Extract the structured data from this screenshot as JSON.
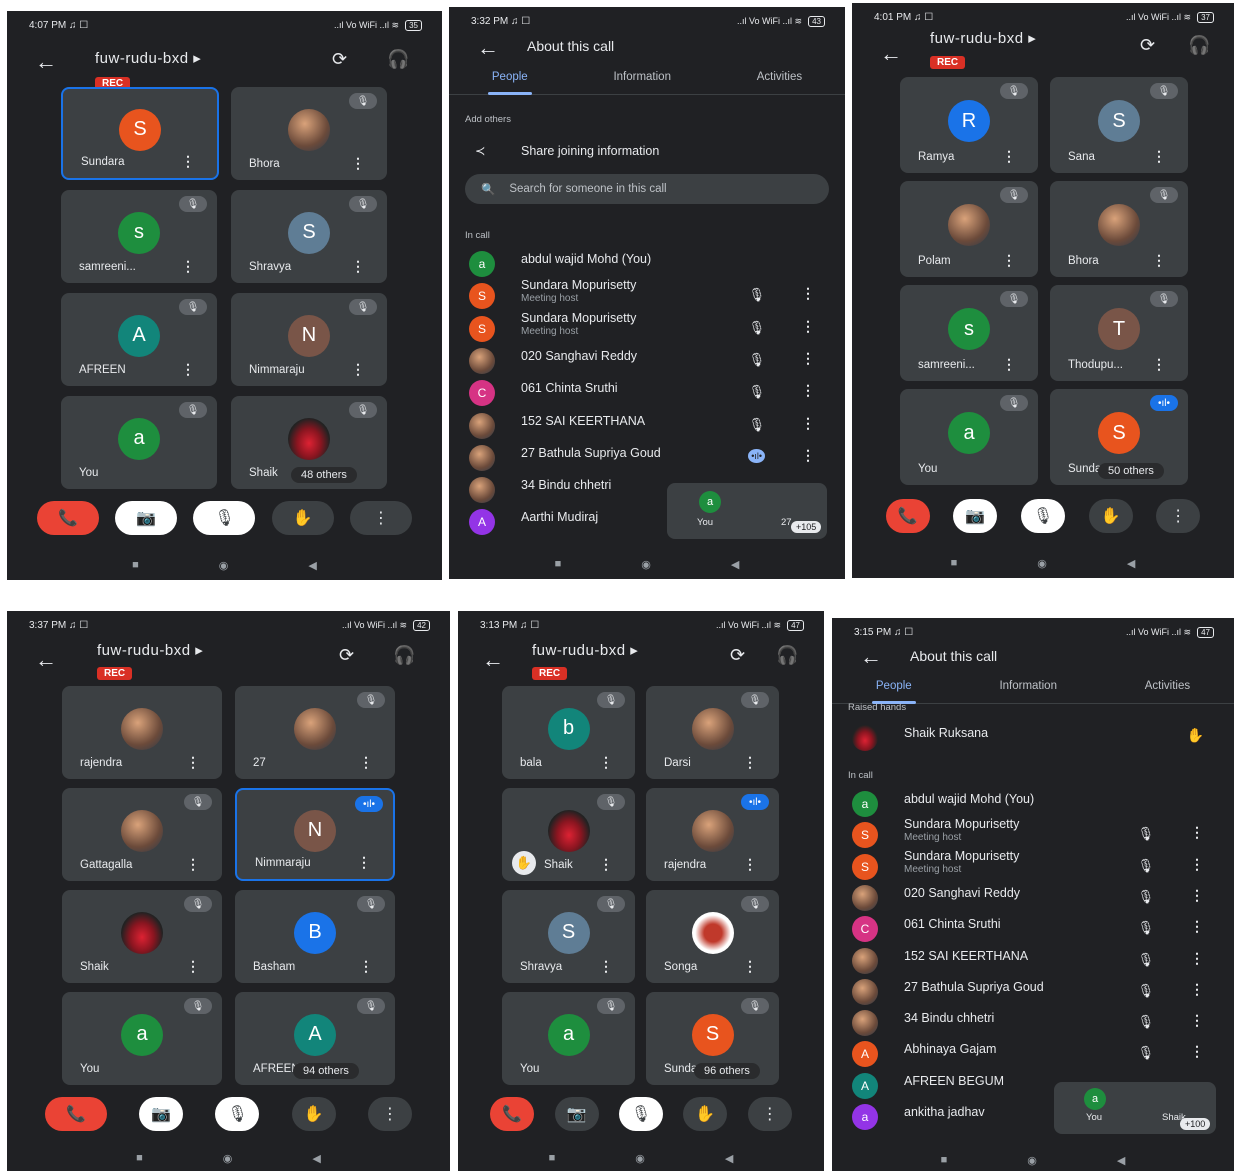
{
  "colors": {
    "bg": "#202124",
    "tile": "#3c4043",
    "accent": "#8ab4f8",
    "end_call": "#ea4335",
    "rec": "#d93025"
  },
  "icons": {
    "back": "←",
    "more": "⋮",
    "mic_off": "🎙",
    "flip": "⟳",
    "headset": "🎧",
    "hangup": "📞",
    "cam_off": "📷",
    "hand": "✋",
    "share": "≺",
    "search": "🔍",
    "speaking": "•ıl•",
    "raised": "✋"
  },
  "status": {
    "signal": "..ıl Vo WiFi ..ıl ≋"
  },
  "meeting_code": "fuw-rudu-bxd ▸",
  "rec_label": "REC",
  "nav": {
    "recent": "■",
    "home": "◉",
    "back": "◀"
  },
  "screens": {
    "s1": {
      "time": "4:07 PM ♫ ☐",
      "battery": "35",
      "tiles": [
        {
          "name": "Sundara",
          "initial": "S"
        },
        {
          "name": "Bhora"
        },
        {
          "name": "samreeni...",
          "initial": "s"
        },
        {
          "name": "Shravya",
          "initial": "S"
        },
        {
          "name": "AFREEN",
          "initial": "A"
        },
        {
          "name": "Nimmaraju",
          "initial": "N"
        },
        {
          "name": "You",
          "initial": "a"
        },
        {
          "name": "Shaik"
        }
      ],
      "others": "48 others"
    },
    "s3": {
      "time": "4:01 PM ♫ ☐",
      "battery": "37",
      "tiles": [
        {
          "name": "Ramya",
          "initial": "R"
        },
        {
          "name": "Sana",
          "initial": "S"
        },
        {
          "name": "Polam"
        },
        {
          "name": "Bhora"
        },
        {
          "name": "samreeni...",
          "initial": "s"
        },
        {
          "name": "Thodupu...",
          "initial": "T"
        },
        {
          "name": "You",
          "initial": "a"
        },
        {
          "name": "Sundara",
          "initial": "S"
        }
      ],
      "others": "50 others"
    },
    "s4": {
      "time": "3:37 PM ♫ ☐",
      "battery": "42",
      "tiles": [
        {
          "name": "rajendra"
        },
        {
          "name": "27"
        },
        {
          "name": "Gattagalla"
        },
        {
          "name": "Nimmaraju",
          "initial": "N"
        },
        {
          "name": "Shaik"
        },
        {
          "name": "Basham",
          "initial": "B"
        },
        {
          "name": "You",
          "initial": "a"
        },
        {
          "name": "AFREEN",
          "initial": "A"
        }
      ],
      "others": "94 others"
    },
    "s5": {
      "time": "3:13 PM ♫ ☐",
      "battery": "47",
      "tiles": [
        {
          "name": "bala",
          "initial": "b"
        },
        {
          "name": "Darsi"
        },
        {
          "name": "Shaik"
        },
        {
          "name": "rajendra"
        },
        {
          "name": "Shravya",
          "initial": "S"
        },
        {
          "name": "Songa"
        },
        {
          "name": "You",
          "initial": "a"
        },
        {
          "name": "Sundara",
          "initial": "S"
        }
      ],
      "others": "96 others"
    },
    "s2": {
      "time": "3:32 PM ♫ ☐",
      "battery": "43",
      "title": "About this call",
      "tabs": [
        "People",
        "Information",
        "Activities"
      ],
      "add_others": "Add others",
      "share": "Share joining information",
      "search_placeholder": "Search for someone in this call",
      "in_call": "In call",
      "people": [
        {
          "name": "abdul wajid Mohd (You)",
          "initial": "a"
        },
        {
          "name": "Sundara Mopurisetty",
          "sub": "Meeting host",
          "initial": "S"
        },
        {
          "name": "Sundara Mopurisetty",
          "sub": "Meeting host",
          "initial": "S"
        },
        {
          "name": "020 Sanghavi Reddy"
        },
        {
          "name": "061 Chinta Sruthi",
          "initial": "C"
        },
        {
          "name": "152 SAI KEERTHANA"
        },
        {
          "name": "27 Bathula Supriya Goud"
        },
        {
          "name": "34 Bindu chhetri"
        },
        {
          "name": "Aarthi Mudiraj",
          "initial": "A"
        }
      ],
      "pip": {
        "you": "You",
        "initial": "a",
        "other": "27",
        "count": "+105"
      }
    },
    "s6": {
      "time": "3:15 PM ♫ ☐",
      "battery": "47",
      "title": "About this call",
      "tabs": [
        "People",
        "Information",
        "Activities"
      ],
      "raised_hands": "Raised hands",
      "raised_name": "Shaik Ruksana",
      "in_call": "In call",
      "people": [
        {
          "name": "abdul wajid Mohd (You)",
          "initial": "a"
        },
        {
          "name": "Sundara Mopurisetty",
          "sub": "Meeting host",
          "initial": "S"
        },
        {
          "name": "Sundara Mopurisetty",
          "sub": "Meeting host",
          "initial": "S"
        },
        {
          "name": "020 Sanghavi Reddy"
        },
        {
          "name": "061 Chinta Sruthi",
          "initial": "C"
        },
        {
          "name": "152 SAI KEERTHANA"
        },
        {
          "name": "27 Bathula Supriya Goud"
        },
        {
          "name": "34 Bindu chhetri"
        },
        {
          "name": "Abhinaya Gajam",
          "initial": "A"
        },
        {
          "name": "AFREEN BEGUM",
          "initial": "A"
        },
        {
          "name": "ankitha jadhav",
          "initial": "a"
        }
      ],
      "pip": {
        "you": "You",
        "initial": "a",
        "other": "Shaik",
        "count": "+100"
      }
    }
  }
}
